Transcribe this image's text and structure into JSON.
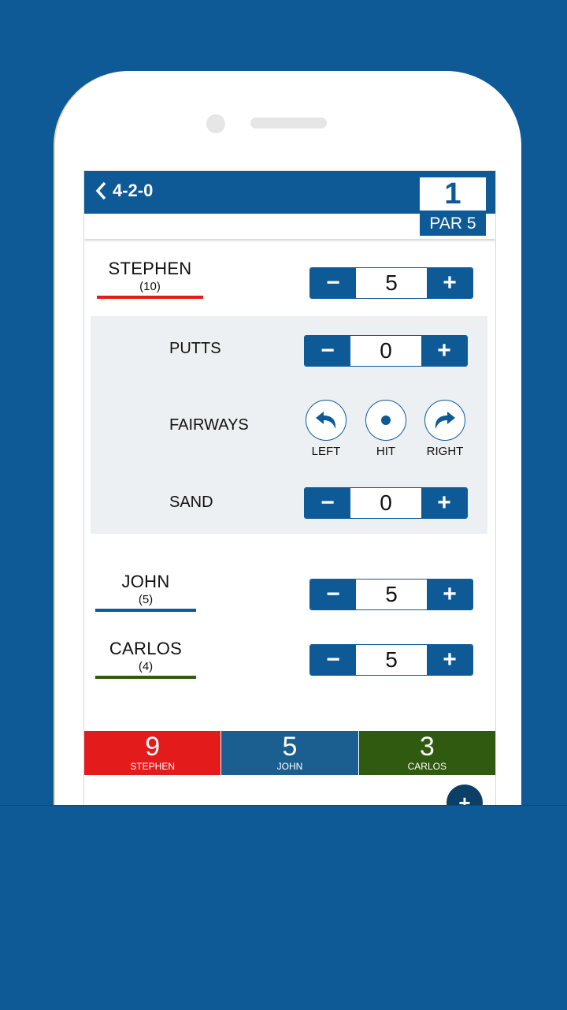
{
  "header": {
    "title": "4-2-0",
    "hole": "1",
    "par": "PAR 5"
  },
  "players": [
    {
      "name": "STEPHEN",
      "handicap": "(10)",
      "score": "5",
      "color": "#e31b1b"
    },
    {
      "name": "JOHN",
      "handicap": "(5)",
      "score": "5",
      "color": "#0d5a96"
    },
    {
      "name": "CARLOS",
      "handicap": "(4)",
      "score": "5",
      "color": "#2f5a10"
    }
  ],
  "stats": {
    "putts_label": "PUTTS",
    "putts_value": "0",
    "fairways_label": "FAIRWAYS",
    "fairway_options": [
      "LEFT",
      "HIT",
      "RIGHT"
    ],
    "sand_label": "SAND",
    "sand_value": "0"
  },
  "stepper": {
    "minus": "−",
    "plus": "+"
  },
  "totals": [
    {
      "value": "9",
      "name": "STEPHEN",
      "color": "#e31b1b"
    },
    {
      "value": "5",
      "name": "JOHN",
      "color": "#1a5f8f"
    },
    {
      "value": "3",
      "name": "CARLOS",
      "color": "#2f5a10"
    }
  ],
  "fab_label": "+"
}
